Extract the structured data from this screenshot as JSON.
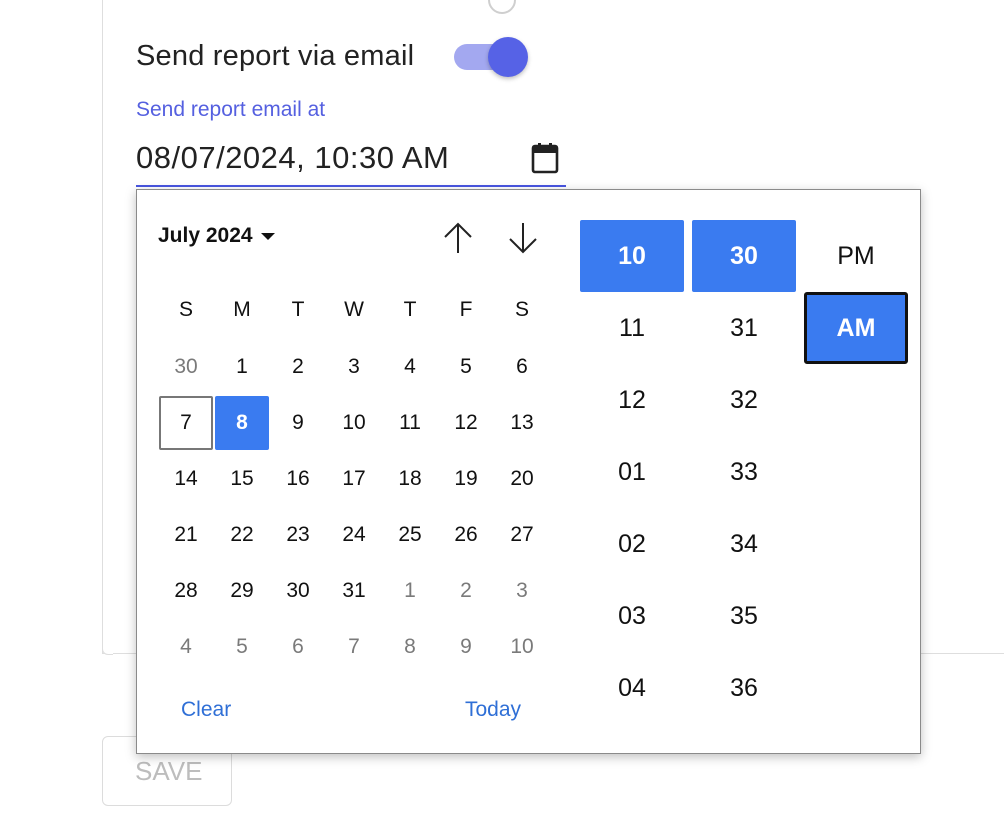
{
  "form": {
    "email_toggle_label": "Send report via email",
    "email_toggle_on": true,
    "field_label": "Send report email at",
    "field_value": "08/07/2024, 10:30 AM",
    "save_label": "SAVE"
  },
  "picker": {
    "month_label": "July 2024",
    "weekdays": [
      "S",
      "M",
      "T",
      "W",
      "T",
      "F",
      "S"
    ],
    "weeks": [
      [
        "30",
        "1",
        "2",
        "3",
        "4",
        "5",
        "6"
      ],
      [
        "7",
        "8",
        "9",
        "10",
        "11",
        "12",
        "13"
      ],
      [
        "14",
        "15",
        "16",
        "17",
        "18",
        "19",
        "20"
      ],
      [
        "21",
        "22",
        "23",
        "24",
        "25",
        "26",
        "27"
      ],
      [
        "28",
        "29",
        "30",
        "31",
        "1",
        "2",
        "3"
      ],
      [
        "4",
        "5",
        "6",
        "7",
        "8",
        "9",
        "10"
      ]
    ],
    "today_day": "7",
    "selected_day": "8",
    "clear_label": "Clear",
    "today_label": "Today",
    "hours": [
      "10",
      "11",
      "12",
      "01",
      "02",
      "03",
      "04"
    ],
    "minutes": [
      "30",
      "31",
      "32",
      "33",
      "34",
      "35",
      "36"
    ],
    "meridiem": [
      "PM",
      "AM"
    ],
    "selected_hour": "10",
    "selected_minute": "30",
    "selected_meridiem": "AM"
  },
  "icons": {
    "calendar": "calendar-icon",
    "up": "arrow-up-icon",
    "down": "arrow-down-icon",
    "caret": "caret-down-icon"
  },
  "colors": {
    "accent": "#5662e6",
    "selected": "#3a7bf0",
    "link": "#2f6fd6"
  }
}
